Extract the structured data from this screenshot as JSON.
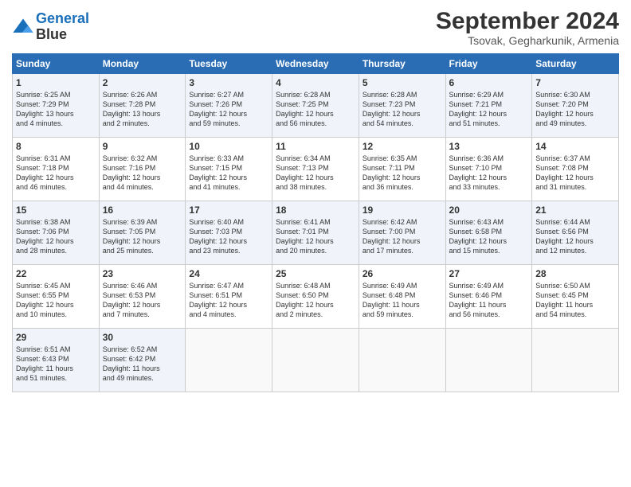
{
  "header": {
    "logo_line1": "General",
    "logo_line2": "Blue",
    "month": "September 2024",
    "location": "Tsovak, Gegharkunik, Armenia"
  },
  "days_of_week": [
    "Sunday",
    "Monday",
    "Tuesday",
    "Wednesday",
    "Thursday",
    "Friday",
    "Saturday"
  ],
  "weeks": [
    [
      {
        "day": 1,
        "rise": "6:25 AM",
        "set": "7:29 PM",
        "daylight": "13 hours and 4 minutes."
      },
      {
        "day": 2,
        "rise": "6:26 AM",
        "set": "7:28 PM",
        "daylight": "13 hours and 2 minutes."
      },
      {
        "day": 3,
        "rise": "6:27 AM",
        "set": "7:26 PM",
        "daylight": "12 hours and 59 minutes."
      },
      {
        "day": 4,
        "rise": "6:28 AM",
        "set": "7:25 PM",
        "daylight": "12 hours and 56 minutes."
      },
      {
        "day": 5,
        "rise": "6:28 AM",
        "set": "7:23 PM",
        "daylight": "12 hours and 54 minutes."
      },
      {
        "day": 6,
        "rise": "6:29 AM",
        "set": "7:21 PM",
        "daylight": "12 hours and 51 minutes."
      },
      {
        "day": 7,
        "rise": "6:30 AM",
        "set": "7:20 PM",
        "daylight": "12 hours and 49 minutes."
      }
    ],
    [
      {
        "day": 8,
        "rise": "6:31 AM",
        "set": "7:18 PM",
        "daylight": "12 hours and 46 minutes."
      },
      {
        "day": 9,
        "rise": "6:32 AM",
        "set": "7:16 PM",
        "daylight": "12 hours and 44 minutes."
      },
      {
        "day": 10,
        "rise": "6:33 AM",
        "set": "7:15 PM",
        "daylight": "12 hours and 41 minutes."
      },
      {
        "day": 11,
        "rise": "6:34 AM",
        "set": "7:13 PM",
        "daylight": "12 hours and 38 minutes."
      },
      {
        "day": 12,
        "rise": "6:35 AM",
        "set": "7:11 PM",
        "daylight": "12 hours and 36 minutes."
      },
      {
        "day": 13,
        "rise": "6:36 AM",
        "set": "7:10 PM",
        "daylight": "12 hours and 33 minutes."
      },
      {
        "day": 14,
        "rise": "6:37 AM",
        "set": "7:08 PM",
        "daylight": "12 hours and 31 minutes."
      }
    ],
    [
      {
        "day": 15,
        "rise": "6:38 AM",
        "set": "7:06 PM",
        "daylight": "12 hours and 28 minutes."
      },
      {
        "day": 16,
        "rise": "6:39 AM",
        "set": "7:05 PM",
        "daylight": "12 hours and 25 minutes."
      },
      {
        "day": 17,
        "rise": "6:40 AM",
        "set": "7:03 PM",
        "daylight": "12 hours and 23 minutes."
      },
      {
        "day": 18,
        "rise": "6:41 AM",
        "set": "7:01 PM",
        "daylight": "12 hours and 20 minutes."
      },
      {
        "day": 19,
        "rise": "6:42 AM",
        "set": "7:00 PM",
        "daylight": "12 hours and 17 minutes."
      },
      {
        "day": 20,
        "rise": "6:43 AM",
        "set": "6:58 PM",
        "daylight": "12 hours and 15 minutes."
      },
      {
        "day": 21,
        "rise": "6:44 AM",
        "set": "6:56 PM",
        "daylight": "12 hours and 12 minutes."
      }
    ],
    [
      {
        "day": 22,
        "rise": "6:45 AM",
        "set": "6:55 PM",
        "daylight": "12 hours and 10 minutes."
      },
      {
        "day": 23,
        "rise": "6:46 AM",
        "set": "6:53 PM",
        "daylight": "12 hours and 7 minutes."
      },
      {
        "day": 24,
        "rise": "6:47 AM",
        "set": "6:51 PM",
        "daylight": "12 hours and 4 minutes."
      },
      {
        "day": 25,
        "rise": "6:48 AM",
        "set": "6:50 PM",
        "daylight": "12 hours and 2 minutes."
      },
      {
        "day": 26,
        "rise": "6:49 AM",
        "set": "6:48 PM",
        "daylight": "11 hours and 59 minutes."
      },
      {
        "day": 27,
        "rise": "6:49 AM",
        "set": "6:46 PM",
        "daylight": "11 hours and 56 minutes."
      },
      {
        "day": 28,
        "rise": "6:50 AM",
        "set": "6:45 PM",
        "daylight": "11 hours and 54 minutes."
      }
    ],
    [
      {
        "day": 29,
        "rise": "6:51 AM",
        "set": "6:43 PM",
        "daylight": "11 hours and 51 minutes."
      },
      {
        "day": 30,
        "rise": "6:52 AM",
        "set": "6:42 PM",
        "daylight": "11 hours and 49 minutes."
      },
      null,
      null,
      null,
      null,
      null
    ]
  ]
}
